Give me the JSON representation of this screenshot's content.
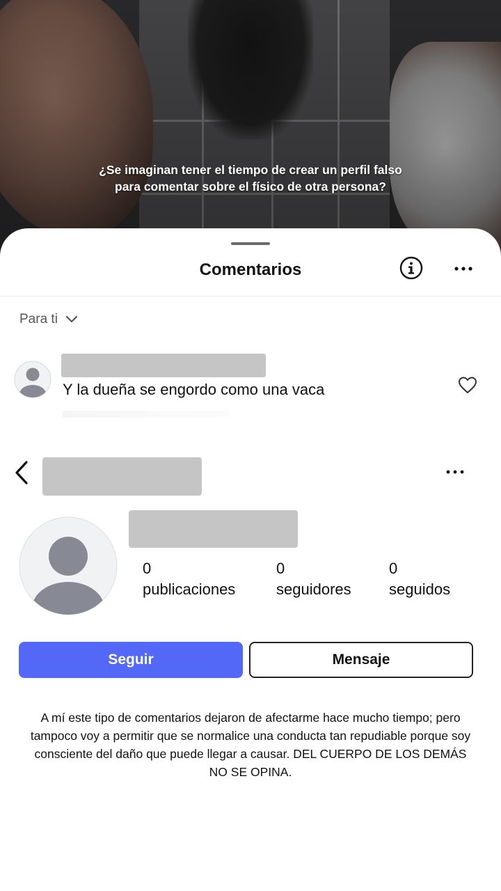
{
  "post": {
    "caption_line1": "¿Se imaginan tener el tiempo de crear un perfil falso",
    "caption_line2": "para comentar sobre el físico de otra persona?"
  },
  "comments_sheet": {
    "title": "Comentarios",
    "info_icon": "info-icon",
    "more_icon": "more-horizontal-icon",
    "filter_label": "Para ti",
    "filter_icon": "chevron-down-icon"
  },
  "comment": {
    "username": "",
    "text": "Y la dueña se engordo como una vaca",
    "like_icon": "heart-icon"
  },
  "profile": {
    "back_icon": "chevron-left-icon",
    "more_icon": "more-horizontal-icon",
    "stats": [
      {
        "value": "0",
        "label": "publicaciones"
      },
      {
        "value": "0",
        "label": "seguidores"
      },
      {
        "value": "0",
        "label": "seguidos"
      }
    ],
    "follow_label": "Seguir",
    "message_label": "Mensaje"
  },
  "note": "A mí este tipo de comentarios dejaron de afectarme hace mucho tiempo; pero tampoco voy a permitir que se normalice una conducta tan repudiable porque soy consciente del daño que puede llegar a causar. DEL CUERPO DE LOS DEMÁS NO SE OPINA.",
  "colors": {
    "follow_button": "#5468f7",
    "sheet_background": "#ffffff"
  }
}
